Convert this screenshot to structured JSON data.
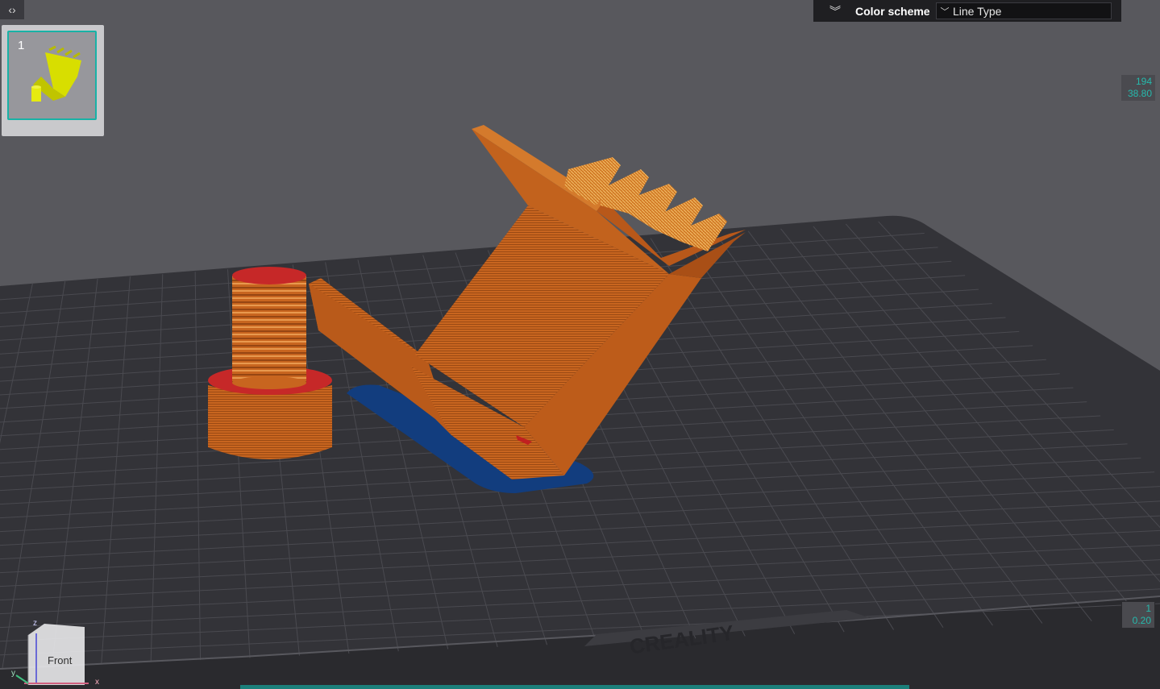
{
  "sidebar": {
    "collapse_icon": "code-chevrons-icon"
  },
  "plate_list": {
    "items": [
      {
        "index": "1"
      }
    ]
  },
  "color_scheme": {
    "label": "Color scheme",
    "value": "Line Type",
    "toggle_icon": "double-chevron-down-icon"
  },
  "layer_slider": {
    "top": {
      "layer": "194",
      "height": "38.80"
    },
    "bottom": {
      "layer": "1",
      "height": "0.20"
    }
  },
  "view_cube": {
    "face": "Front",
    "axes": {
      "x": "x",
      "y": "y",
      "z": "z"
    }
  },
  "bed": {
    "brand": "CREALITY"
  },
  "colors": {
    "accent": "#18b2a6",
    "model": "#c8641e",
    "brim": "#0f3a78",
    "bed": "#2e2e33"
  }
}
